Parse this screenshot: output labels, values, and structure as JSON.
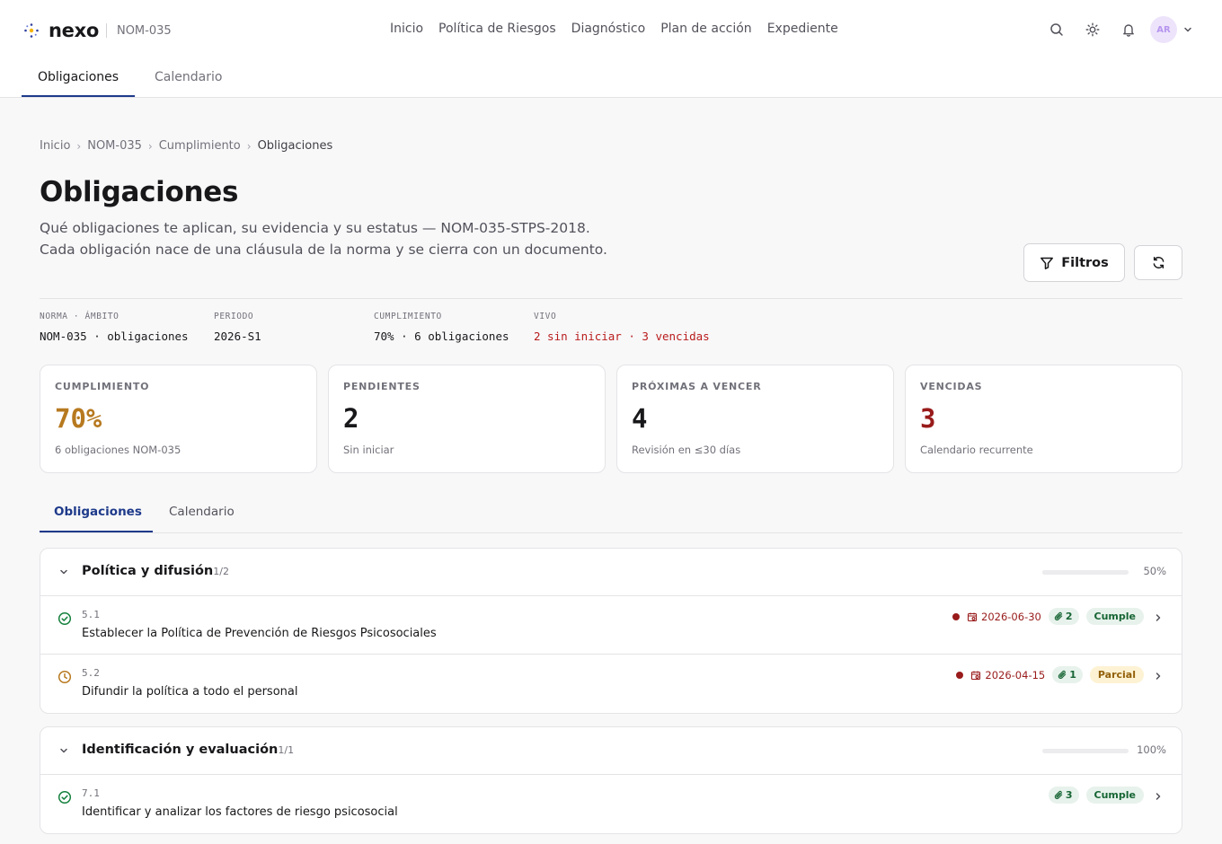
{
  "brand": {
    "name": "nexo",
    "code": "NOM-035"
  },
  "nav": [
    "Inicio",
    "Política de Riesgos",
    "Diagnóstico",
    "Plan de acción",
    "Expediente"
  ],
  "user": {
    "initials": "AR"
  },
  "subnav": {
    "tabs": [
      "Obligaciones",
      "Calendario"
    ],
    "active": "Obligaciones"
  },
  "breadcrumb": [
    "Inicio",
    "NOM-035",
    "Cumplimiento",
    "Obligaciones"
  ],
  "page": {
    "title": "Obligaciones",
    "description": "Qué obligaciones te aplican, su evidencia y su estatus — NOM-035-STPS-2018. Cada obligación nace de una cláusula de la norma y se cierra con un documento."
  },
  "actions": {
    "filters_label": "Filtros"
  },
  "meta": [
    {
      "key": "NORMA · ÁMBITO",
      "value": "NOM-035 · obligaciones"
    },
    {
      "key": "PERIODO",
      "value": "2026-S1"
    },
    {
      "key": "CUMPLIMIENTO",
      "value": "70% · 6 obligaciones"
    },
    {
      "key": "VIVO",
      "value": "2 sin iniciar · 3 vencidas"
    }
  ],
  "stats": [
    {
      "label": "CUMPLIMIENTO",
      "value": "70%",
      "sub": "6 obligaciones NOM-035",
      "color": "#b7791f"
    },
    {
      "label": "PENDIENTES",
      "value": "2",
      "sub": "Sin iniciar",
      "color": "#18181b"
    },
    {
      "label": "PRÓXIMAS A VENCER",
      "value": "4",
      "sub": "Revisión en ≤30 días",
      "color": "#18181b"
    },
    {
      "label": "VENCIDAS",
      "value": "3",
      "sub": "Calendario recurrente",
      "color": "#991b1b"
    }
  ],
  "content_tabs": [
    "Obligaciones",
    "Calendario"
  ],
  "groups": [
    {
      "title": "Política y difusión",
      "count": "1/2",
      "progress": 0.5,
      "percent": "50%",
      "items": [
        {
          "code": "5.1",
          "title": "Establecer la Política de Prevención de Riesgos Psicosociales",
          "due": "2026-06-30",
          "evidence": "2",
          "status": "Cumple",
          "state": "done"
        },
        {
          "code": "5.2",
          "title": "Difundir la política a todo el personal",
          "due": "2026-04-15",
          "evidence": "1",
          "status": "Parcial",
          "state": "pending"
        }
      ]
    },
    {
      "title": "Identificación y evaluación",
      "count": "1/1",
      "progress": 1,
      "percent": "100%",
      "items": [
        {
          "code": "7.1",
          "title": "Identificar y analizar los factores de riesgo psicosocial",
          "evidence": "3",
          "status": "Cumple",
          "state": "done"
        }
      ]
    }
  ],
  "colors": {
    "accent": "#1e3a8a",
    "ok": "#166534",
    "warn": "#b7791f",
    "danger": "#991b1b"
  }
}
